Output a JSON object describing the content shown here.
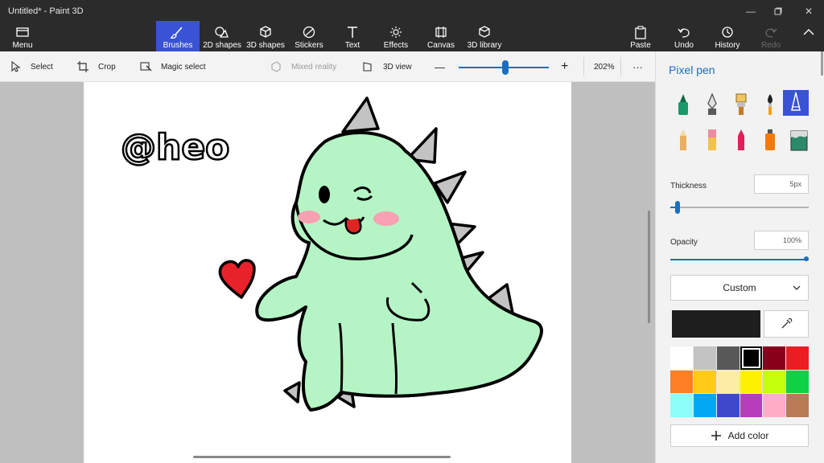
{
  "window": {
    "title": "Untitled* - Paint 3D"
  },
  "ribbon": {
    "menu_label": "Menu",
    "tabs": [
      {
        "label": "Brushes"
      },
      {
        "label": "2D shapes"
      },
      {
        "label": "3D shapes"
      },
      {
        "label": "Stickers"
      },
      {
        "label": "Text"
      },
      {
        "label": "Effects"
      },
      {
        "label": "Canvas"
      },
      {
        "label": "3D library"
      }
    ],
    "right": [
      {
        "label": "Paste"
      },
      {
        "label": "Undo"
      },
      {
        "label": "History"
      },
      {
        "label": "Redo"
      }
    ]
  },
  "toolbar": {
    "select_label": "Select",
    "crop_label": "Crop",
    "magic_select_label": "Magic select",
    "mixed_reality_label": "Mixed reality",
    "view3d_label": "3D view",
    "zoom_minus": "—",
    "zoom_plus": "+",
    "zoom_value": "202%",
    "zoom_level_fraction": 0.52,
    "more_label": "···"
  },
  "canvas": {
    "signature_text": "@heo"
  },
  "panel": {
    "title": "Pixel pen",
    "brushes": [
      {
        "icon": "marker-icon",
        "color": "#1a9a6a"
      },
      {
        "icon": "calligraphy-pen-icon",
        "color": "#5a5a5a"
      },
      {
        "icon": "oil-brush-icon",
        "color": "#f1c463"
      },
      {
        "icon": "watercolor-icon",
        "color": "#f0a020"
      },
      {
        "icon": "pixel-pen-icon",
        "color": "#ffffff",
        "selected": true
      },
      {
        "icon": "pencil-icon",
        "color": "#e8b060"
      },
      {
        "icon": "eraser-icon",
        "color": "#f08aa0"
      },
      {
        "icon": "crayon-icon",
        "color": "#e0205a"
      },
      {
        "icon": "spray-can-icon",
        "color": "#f07a10"
      },
      {
        "icon": "fill-icon",
        "color": "#2a8a6a"
      }
    ],
    "thickness_label": "Thickness",
    "thickness_value": "5px",
    "opacity_label": "Opacity",
    "opacity_value": "100%",
    "color_mode": "Custom",
    "current_color": "#1e1e1e",
    "palette": [
      "#ffffff",
      "#c3c3c3",
      "#585858",
      "#000000",
      "#88001b",
      "#ec1c24",
      "#ff7f27",
      "#ffca18",
      "#fdeca6",
      "#fff200",
      "#c4ff0e",
      "#0ed145",
      "#8cfffb",
      "#00a8f3",
      "#3f48cc",
      "#b83dba",
      "#ffaec8",
      "#b97a56"
    ],
    "selected_swatch_index": 3,
    "add_color_label": "Add color"
  }
}
